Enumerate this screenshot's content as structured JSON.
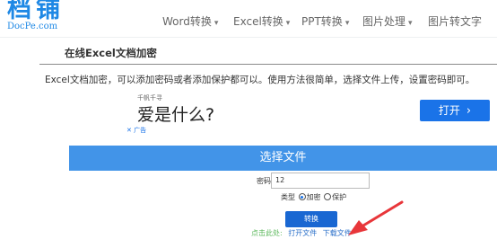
{
  "logo": {
    "cn": "档铺",
    "en": "DocPe.com"
  },
  "nav": [
    {
      "label": "Word转换",
      "dropdown": true
    },
    {
      "label": "Excel转换",
      "dropdown": true
    },
    {
      "label": "PPT转换",
      "dropdown": true
    },
    {
      "label": "图片处理",
      "dropdown": true
    },
    {
      "label": "图片转文字",
      "dropdown": false
    }
  ],
  "page": {
    "title": "在线Excel文档加密",
    "intro": "Excel文档加密，可以添加密码或者添加保护都可以。使用方法很简单，选择文件上传，设置密码即可。"
  },
  "ad": {
    "small": "千帆千寻",
    "main": "爱是什么?",
    "button": "打开",
    "chevron": "›",
    "mark_x": "✕",
    "mark_label": "广告"
  },
  "form": {
    "choose_file": "选择文件",
    "password_label": "密码",
    "password_value": "12",
    "type_label": "类型",
    "options": [
      {
        "label": "加密",
        "selected": true
      },
      {
        "label": "保护",
        "selected": false
      }
    ],
    "convert_button": "转换",
    "result_label": "点击此处:",
    "open_link": "打开文件",
    "download_link": "下载文件"
  },
  "colors": {
    "brand": "#1E88E5",
    "primary_button": "#4294e8",
    "convert_button": "#1967d2",
    "result_label": "#5cb85c",
    "link": "#2a6fc9",
    "arrow": "#e8363a"
  },
  "icons": {
    "dropdown": "caret-down-icon",
    "arrow": "red-arrow-pointer"
  }
}
